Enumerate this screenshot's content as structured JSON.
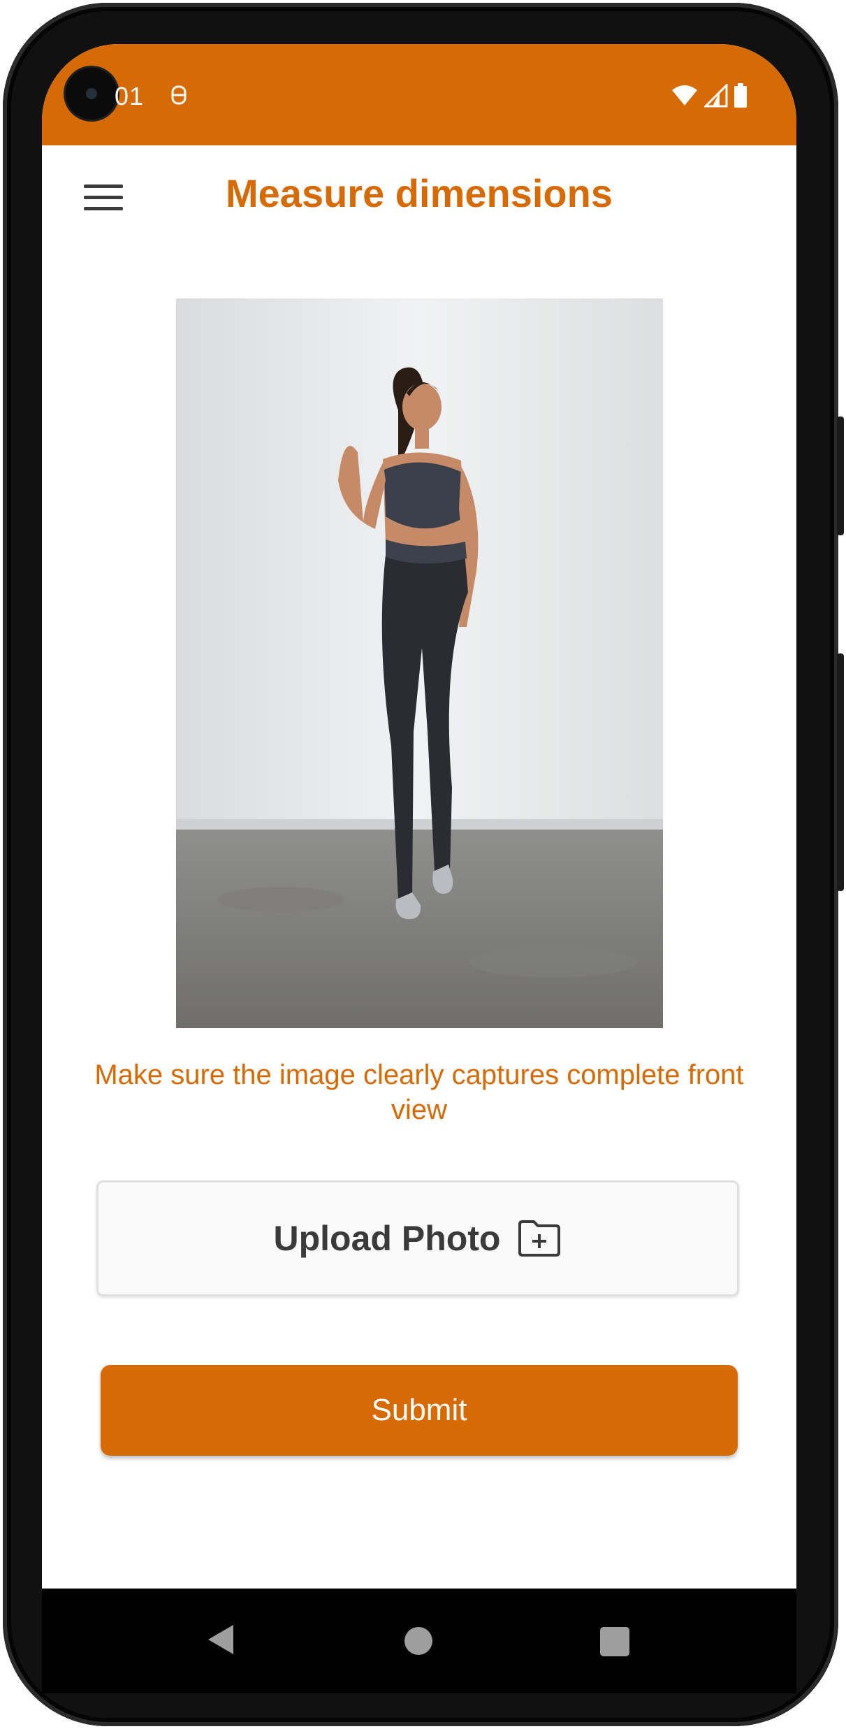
{
  "status_bar": {
    "time": "01",
    "background_color": "#d66a05",
    "icons": [
      "notification-icon",
      "wifi-icon",
      "cellular-signal-icon",
      "battery-icon"
    ]
  },
  "header": {
    "title": "Measure dimensions",
    "menu_icon": "hamburger-menu-icon"
  },
  "main": {
    "photo_alt": "",
    "hint": "Make sure the image clearly captures complete front view",
    "upload_label": "Upload Photo",
    "upload_icon": "folder-plus-icon",
    "submit_label": "Submit"
  },
  "colors": {
    "accent": "#d66a05",
    "upload_border": "#e0e0e0",
    "upload_text": "#3a3a3a"
  },
  "nav_bar": {
    "icons": [
      "back-icon",
      "home-icon",
      "recents-icon"
    ]
  }
}
